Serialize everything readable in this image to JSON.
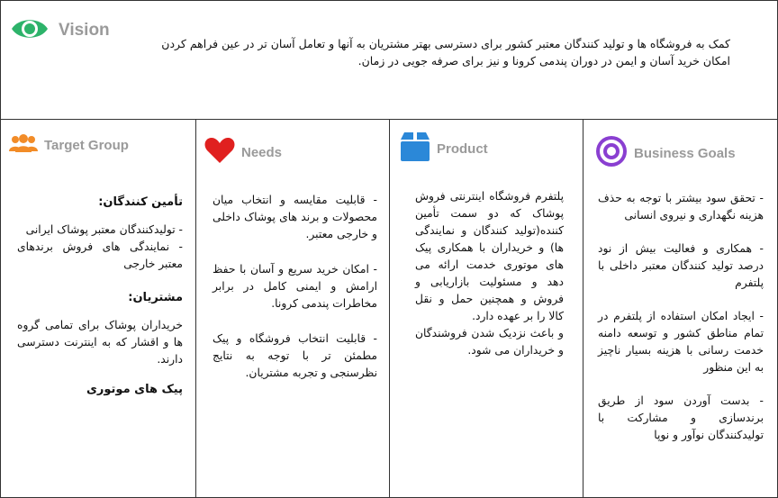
{
  "vision": {
    "icon": "eye-icon",
    "title": "Vision",
    "text": "کمک به فروشگاه ها و تولید کنندگان معتبر کشور برای دسترسی بهتر مشتریان به آنها و تعامل آسان تر در عین فراهم کردن امکان خرید آسان و ایمن در دوران پندمی کرونا و نیز برای صرفه جویی در زمان."
  },
  "target_group": {
    "icon": "people-icon",
    "title": "Target Group",
    "suppliers_heading": "تأمین کنندگان:",
    "suppliers": [
      "- تولیدکنندگان معتبر پوشاک ایرانی",
      "- نمایندگی های فروش برندهای معتبر خارجی"
    ],
    "customers_heading": "مشتریان:",
    "customers": [
      "خریداران پوشاک برای تمامی گروه ها و اقشار که به اینترنت دسترسی دارند."
    ],
    "couriers": "پیک های موتوری"
  },
  "needs": {
    "icon": "heart-icon",
    "title": "Needs",
    "items": [
      "- قابلیت مقایسه و انتخاب میان محصولات و برند های پوشاک داخلی و خارجی معتبر.",
      "- امکان خرید سریع و آسان با حفظ ارامش و ایمنی کامل در برابر مخاطرات پندمی کرونا.",
      "- قابلیت انتخاب فروشگاه و پیک مطمئن تر با توجه به نتایج نظرسنجی و تجربه مشتریان."
    ]
  },
  "product": {
    "icon": "box-icon",
    "title": "Product",
    "items": [
      "پلتفرم فروشگاه اینترنتی فروش پوشاک که دو سمت تأمین کننده(تولید کنندگان و نمایندگی ها) و خریداران با همکاری پیک های موتوری خدمت ارائه می دهد و مسئولیت بازاریابی و فروش و همچنین حمل و نقل کالا را بر عهده دارد.",
      "و باعث نزدیک شدن فروشندگان و خریداران می شود."
    ]
  },
  "business_goals": {
    "icon": "target-icon",
    "title": "Business Goals",
    "items": [
      "- تحقق سود بیشتر با توجه به حذف هزینه نگهداری و نیروی انسانی",
      "- همکاری و فعالیت بیش از نود درصد تولید کنندگان معتبر داخلی با پلتفرم",
      "- ایجاد امکان استفاده از پلتفرم در تمام مناطق کشور و توسعه دامنه خدمت رسانی با هزینه بسیار ناچیز به این منظور",
      "- بدست آوردن سود از طریق برندسازی و مشارکت با تولیدکنندگان نوآور و نوپا"
    ]
  },
  "colors": {
    "eye": "#2db36a",
    "people": "#f28c28",
    "heart": "#e0201f",
    "box": "#2b88d8",
    "target": "#8a3fd1",
    "title_gray": "#9a9a9a"
  }
}
